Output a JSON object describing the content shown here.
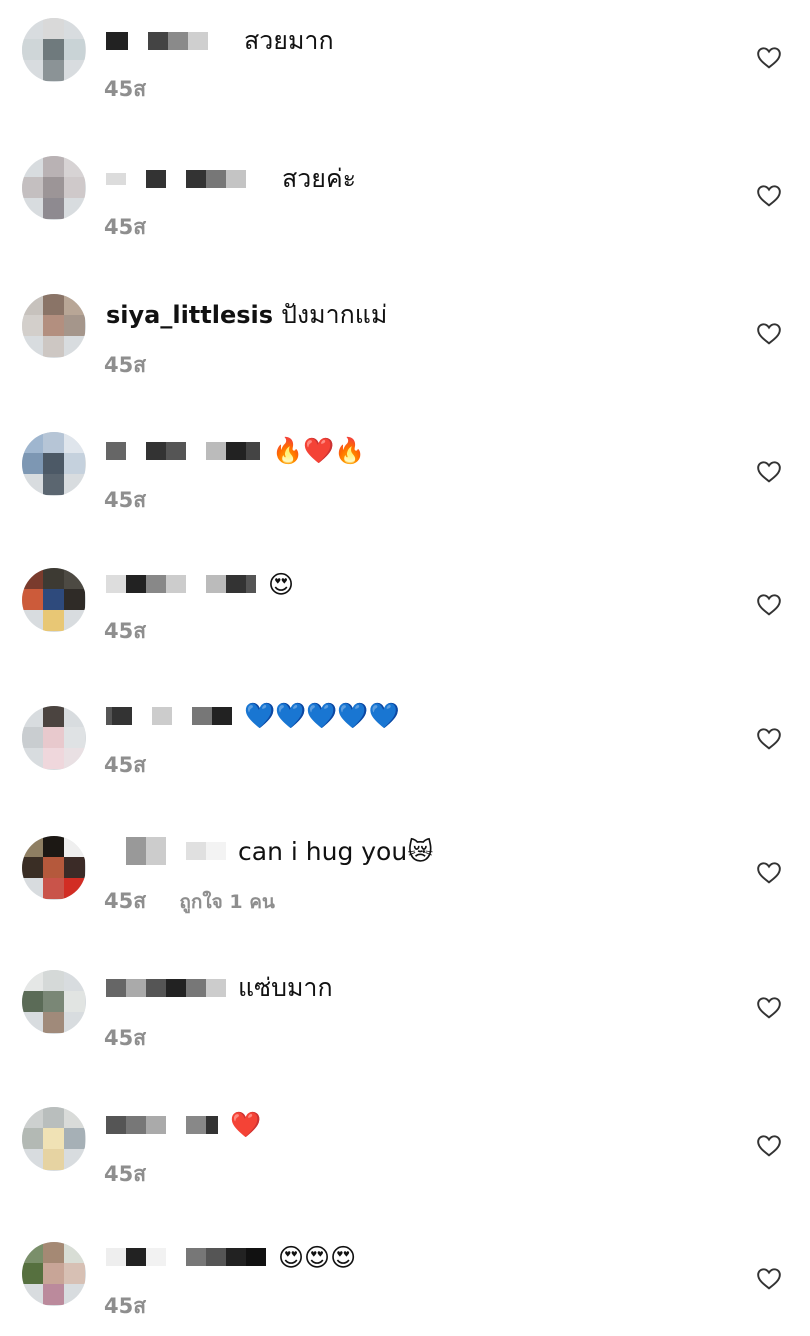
{
  "comments": [
    {
      "username": "",
      "text": "สวยมาก",
      "time": "45ส",
      "likes": ""
    },
    {
      "username": "",
      "text": "สวยค่ะ",
      "time": "45ส",
      "likes": ""
    },
    {
      "username": "siya_littlesis",
      "text": "ปังมากแม่",
      "time": "45ส",
      "likes": ""
    },
    {
      "username": "",
      "text": "🔥❤️🔥",
      "time": "45ส",
      "likes": ""
    },
    {
      "username": "",
      "text": "😍",
      "time": "45ส",
      "likes": ""
    },
    {
      "username": "",
      "text": "💙💙💙💙💙",
      "time": "45ส",
      "likes": ""
    },
    {
      "username": "",
      "text": "can i hug you😿",
      "time": "45ส",
      "likes": "ถูกใจ 1 คน"
    },
    {
      "username": "",
      "text": "แซ่บมาก",
      "time": "45ส",
      "likes": ""
    },
    {
      "username": "",
      "text": "❤️",
      "time": "45ส",
      "likes": ""
    },
    {
      "username": "",
      "text": "😍😍😍",
      "time": "45ส",
      "likes": ""
    }
  ],
  "icons": {
    "like": "heart-outline-icon"
  }
}
